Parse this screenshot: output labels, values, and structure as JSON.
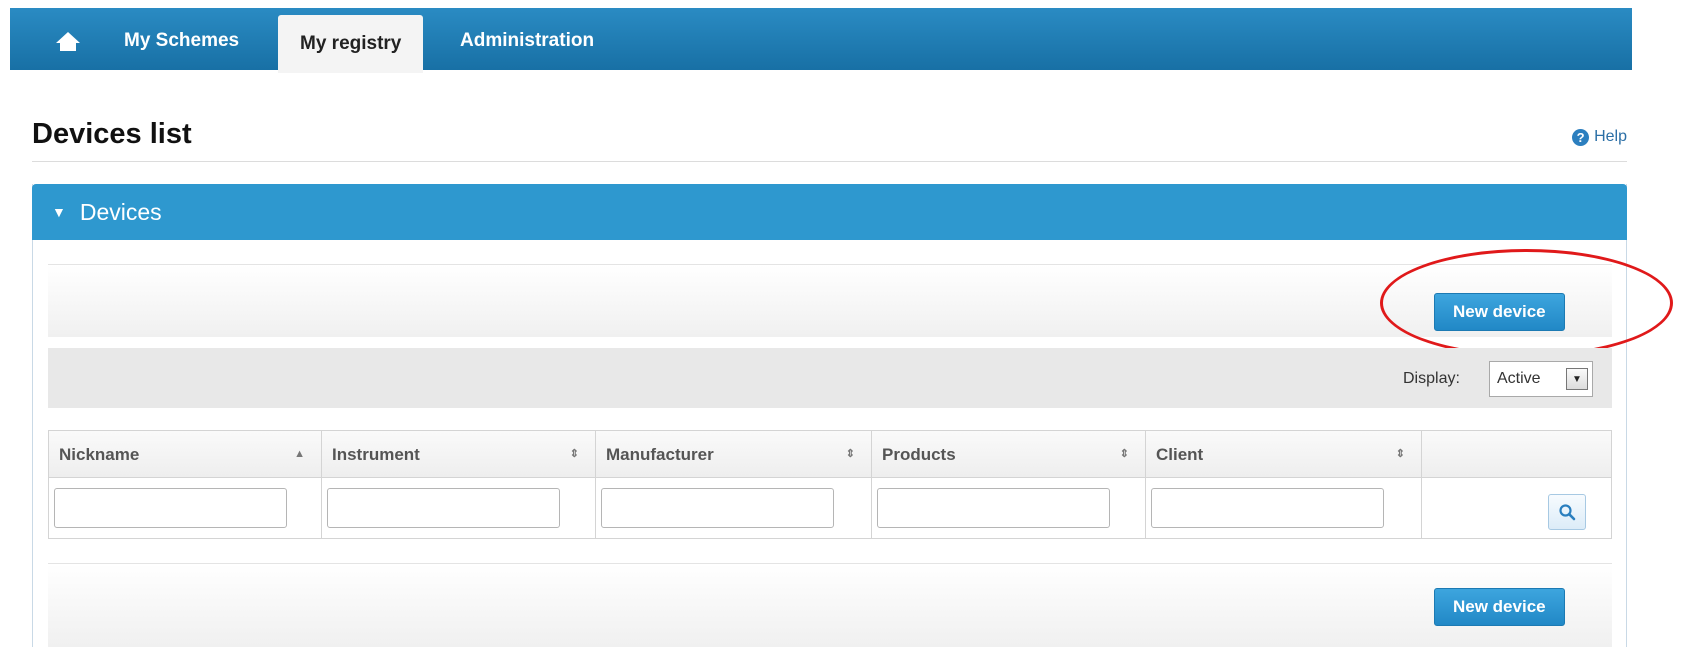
{
  "nav": {
    "home_icon": "home-icon",
    "tabs": [
      {
        "label": "My Schemes"
      },
      {
        "label": "My registry"
      },
      {
        "label": "Administration"
      }
    ],
    "active_tab": "My registry"
  },
  "page": {
    "title": "Devices list",
    "help_label": "Help"
  },
  "panel": {
    "title": "Devices",
    "new_device_label": "New device",
    "display_label": "Display:",
    "display_value": "Active"
  },
  "grid": {
    "columns": [
      {
        "label": "Nickname",
        "sort": "▲"
      },
      {
        "label": "Instrument",
        "sort": "⇕"
      },
      {
        "label": "Manufacturer",
        "sort": "⇕"
      },
      {
        "label": "Products",
        "sort": "⇕"
      },
      {
        "label": "Client",
        "sort": "⇕"
      }
    ],
    "filters": [
      "",
      "",
      "",
      "",
      ""
    ]
  },
  "colors": {
    "nav_blue": "#1870a5",
    "panel_blue": "#2e98cf",
    "button_blue": "#2188c6",
    "highlight_red": "#e0191a"
  }
}
